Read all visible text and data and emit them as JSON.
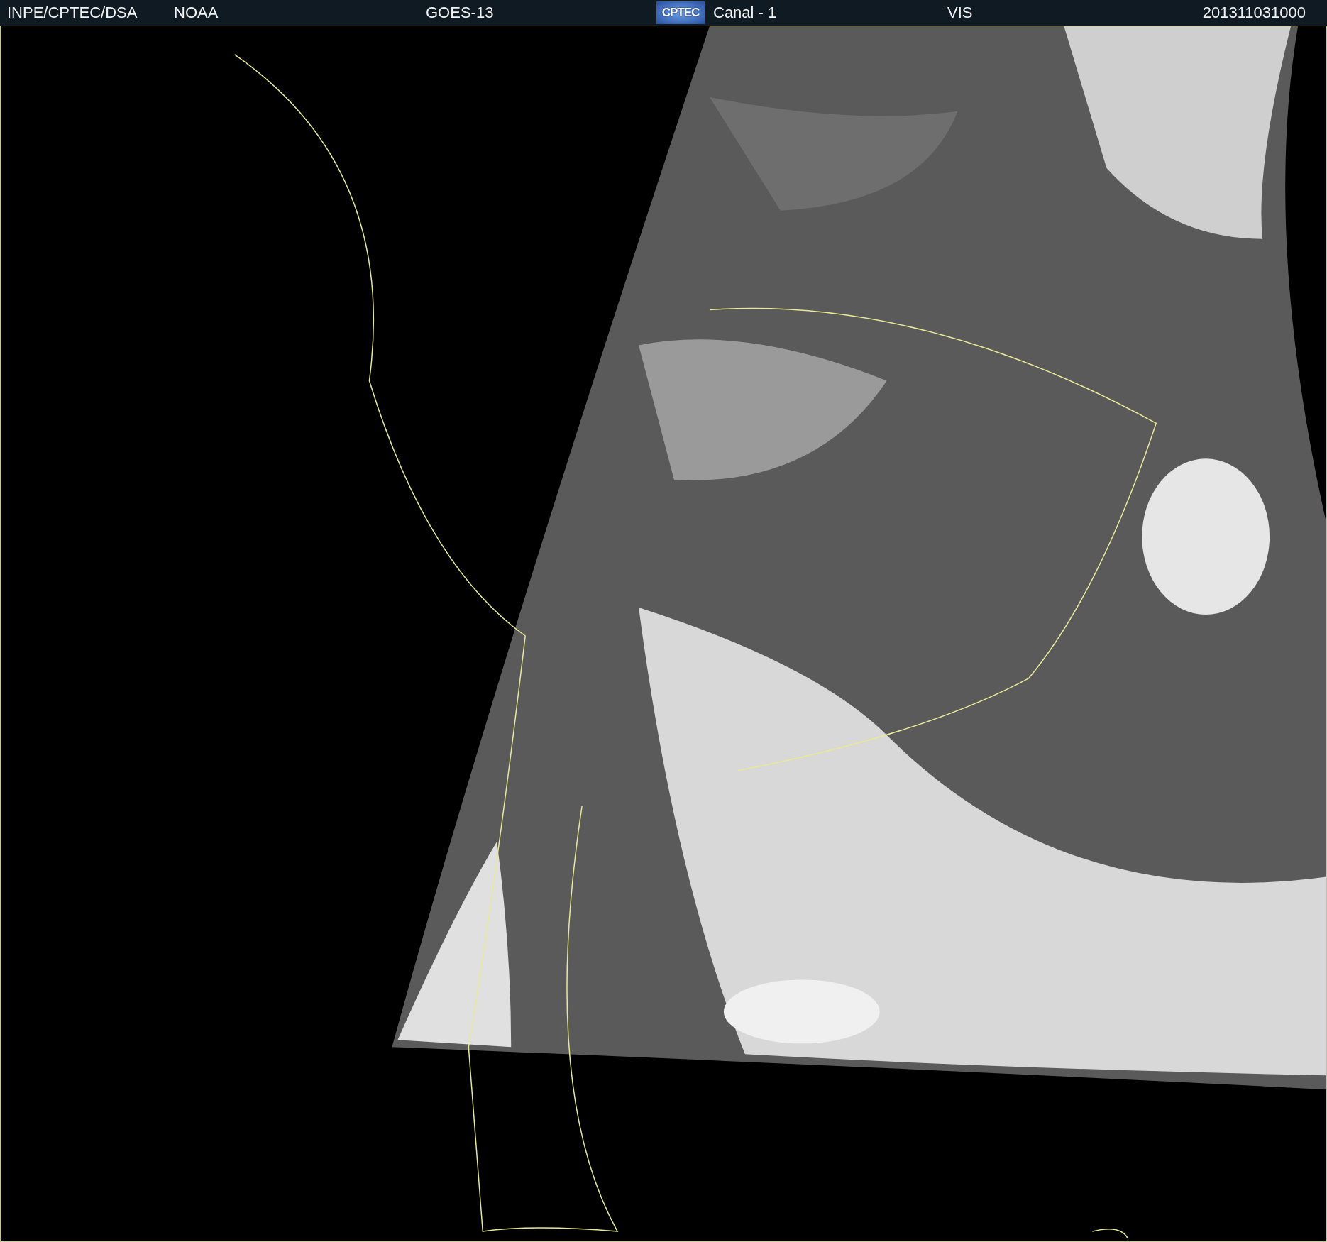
{
  "header": {
    "institution": "INPE/CPTEC/DSA",
    "agency": "NOAA",
    "satellite": "GOES-13",
    "logo": "CPTEC",
    "channel": "Canal - 1",
    "band": "VIS",
    "timestamp": "201311031000"
  }
}
